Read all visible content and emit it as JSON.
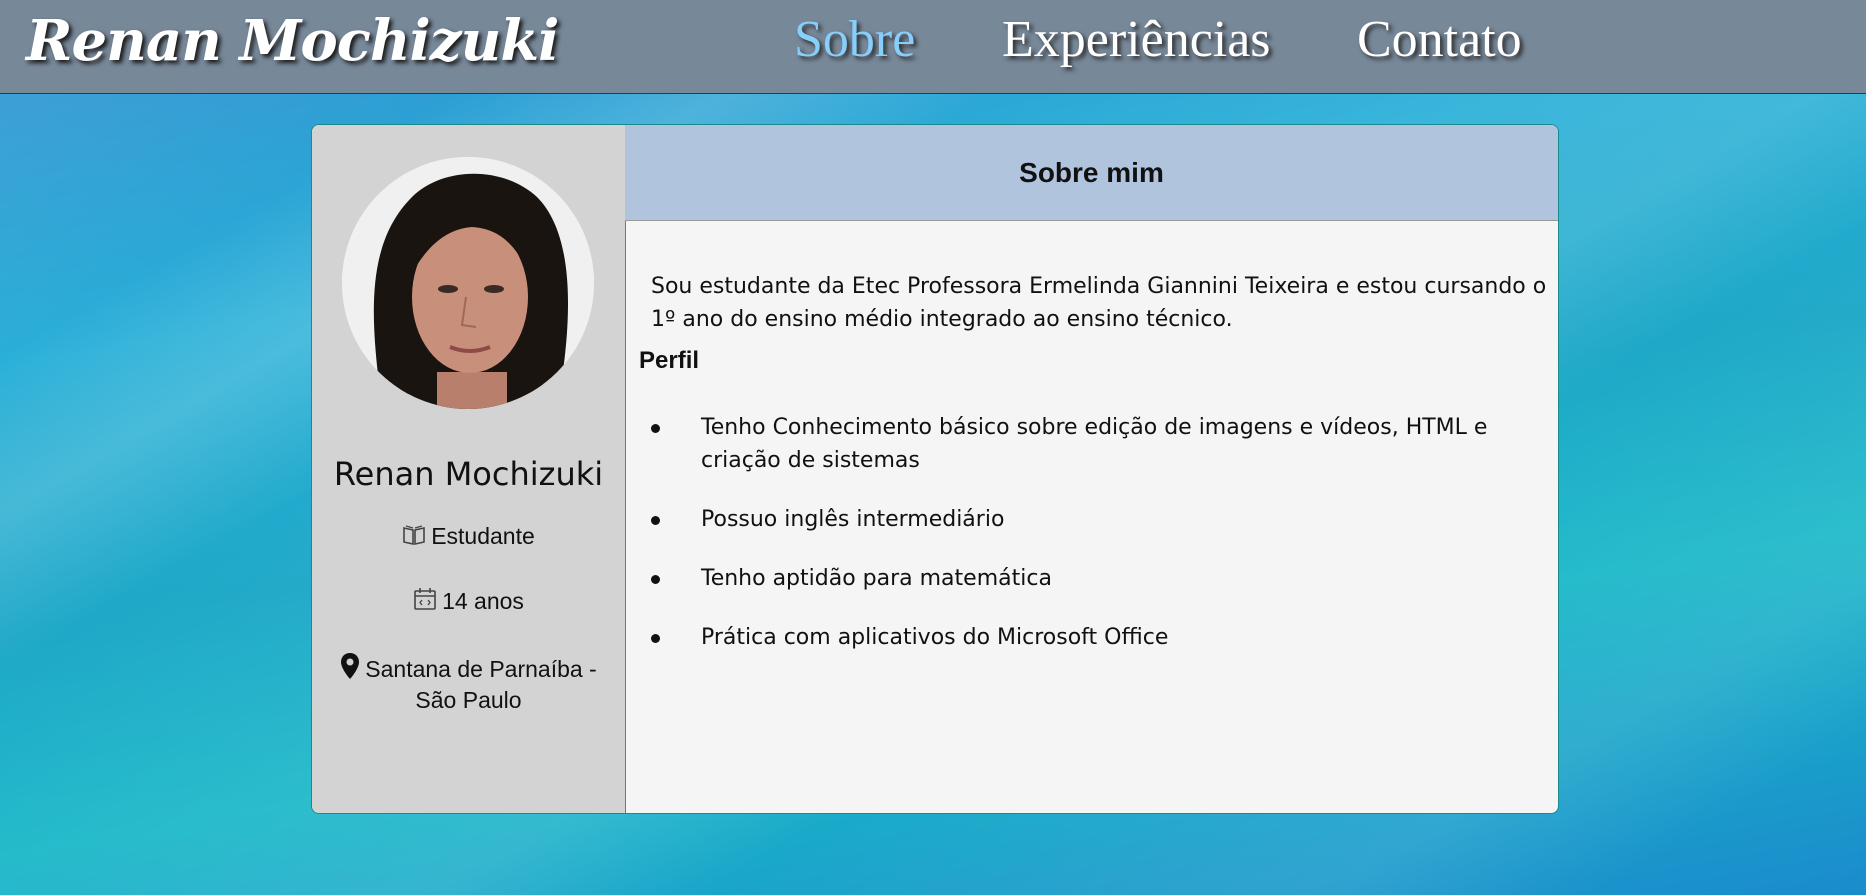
{
  "brand": "Renan Mochizuki",
  "nav": [
    {
      "label": "Sobre",
      "active": true
    },
    {
      "label": "Experiências",
      "active": false
    },
    {
      "label": "Contato",
      "active": false
    }
  ],
  "profile": {
    "name": "Renan Mochizuki",
    "role": "Estudante",
    "age": "14 anos",
    "location": "Santana de Parnaíba - São Paulo"
  },
  "about": {
    "heading": "Sobre mim",
    "intro": "Sou estudante da Etec Professora Ermelinda Giannini Teixeira e estou cursando o 1º ano do ensino médio integrado ao ensino técnico.",
    "profile_heading": "Perfil",
    "items": [
      "Tenho Conhecimento básico sobre edição de imagens e vídeos, HTML e criação de sistemas",
      "Possuo inglês intermediário",
      "Tenho aptidão para matemática",
      "Prática com aplicativos do Microsoft Office"
    ]
  },
  "icons": {
    "role": "book-icon",
    "age": "calendar-icon",
    "location": "map-pin-icon"
  },
  "colors": {
    "navbar": "#778899",
    "nav_active": "#87cefa",
    "sidebar": "#d3d3d3",
    "header": "#b0c4de",
    "content": "#f5f5f5"
  }
}
